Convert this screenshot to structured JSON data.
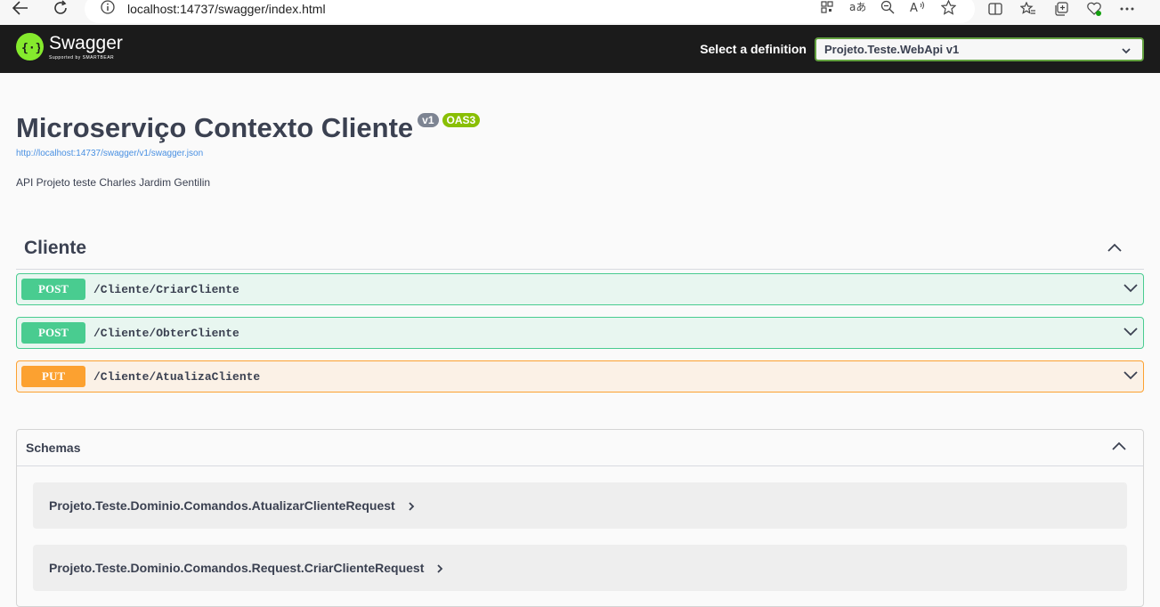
{
  "browser": {
    "url": "localhost:14737/swagger/index.html"
  },
  "topbar": {
    "logo_name": "Swagger",
    "logo_sub": "Supported by SMARTBEAR",
    "definition_label": "Select a definition",
    "definition_value": "Projeto.Teste.WebApi v1"
  },
  "info": {
    "title": "Microserviço Contexto Cliente",
    "version_badge": "v1",
    "oas_badge": "OAS3",
    "spec_url": "http://localhost:14737/swagger/v1/swagger.json",
    "description": "API Projeto teste Charles Jardim Gentilin"
  },
  "tag": {
    "name": "Cliente",
    "operations": [
      {
        "method": "POST",
        "path": "/Cliente/CriarCliente"
      },
      {
        "method": "POST",
        "path": "/Cliente/ObterCliente"
      },
      {
        "method": "PUT",
        "path": "/Cliente/AtualizaCliente"
      }
    ]
  },
  "schemas": {
    "title": "Schemas",
    "models": [
      "Projeto.Teste.Dominio.Comandos.AtualizarClienteRequest",
      "Projeto.Teste.Dominio.Comandos.Request.CriarClienteRequest"
    ]
  },
  "colors": {
    "post": "#49cc90",
    "put": "#fca130",
    "topbar": "#1b1b1b",
    "logo": "#85ea2d"
  }
}
